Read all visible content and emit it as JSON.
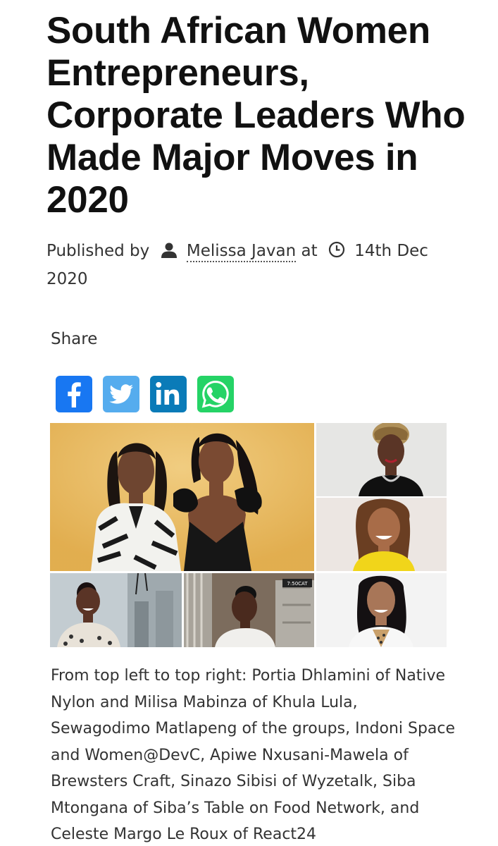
{
  "article": {
    "title": "South African Women Entrepreneurs, Corporate Leaders Who Made Major Moves in 2020",
    "published_by": "Published by",
    "author": "Melissa Javan",
    "at": "at",
    "date": "14th Dec 2020"
  },
  "share": {
    "label": "Share",
    "buttons": [
      {
        "network": "facebook",
        "icon": "facebook-icon",
        "color": "#1877f2"
      },
      {
        "network": "twitter",
        "icon": "twitter-icon",
        "color": "#55acee"
      },
      {
        "network": "linkedin",
        "icon": "linkedin-icon",
        "color": "#0a7bb8"
      },
      {
        "network": "whatsapp",
        "icon": "whatsapp-icon",
        "color": "#25d366"
      }
    ]
  },
  "image_caption": "From top left to top right: Portia Dhlamini of Native Nylon and Milisa Mabinza of Khula Lula, Sewagodimo Matlapeng of the groups, Indoni Space and Women@DevC, Apiwe Nxusani-Mawela of Brewsters Craft, Sinazo Sibisi of Wyzetalk, Siba Mtongana of Siba’s Table on Food Network, and Celeste Margo Le Roux of React24",
  "collage": {
    "overlay_text": "7:50CAT"
  }
}
